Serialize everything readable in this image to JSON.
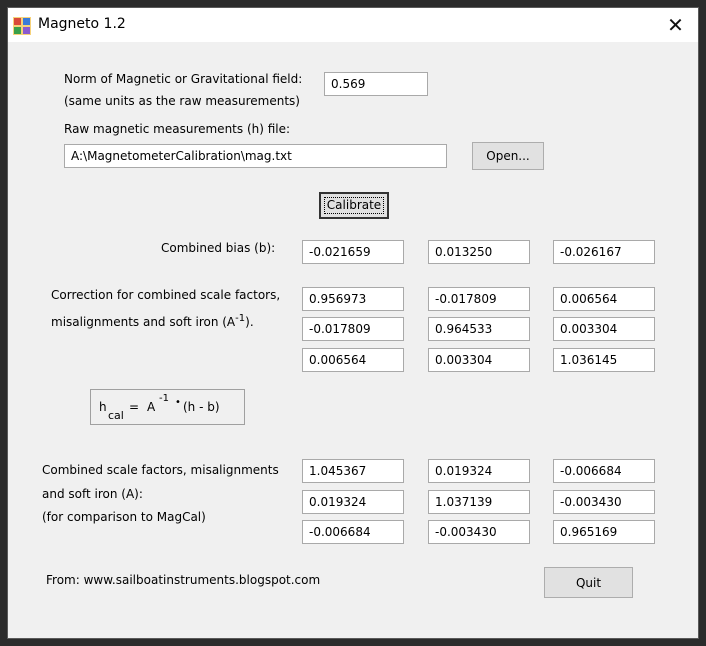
{
  "window": {
    "title": "Magneto 1.2",
    "close_glyph": "✕"
  },
  "norm": {
    "label_line1": "Norm of Magnetic or Gravitational field:",
    "label_line2": "(same units as the raw measurements)",
    "value": "0.569"
  },
  "file": {
    "label": "Raw magnetic measurements (h) file:",
    "path": "A:\\MagnetometerCalibration\\mag.txt",
    "open_label": "Open..."
  },
  "calibrate_label": "Calibrate",
  "bias": {
    "label": "Combined bias (b):",
    "values": [
      "-0.021659",
      "0.013250",
      "-0.026167"
    ]
  },
  "correction": {
    "label_line1": "Correction for combined scale factors,",
    "label_line2_main": "misalignments and soft iron (A",
    "label_line2_sup": "-1",
    "label_line2_end": ").",
    "rows": [
      [
        "0.956973",
        "-0.017809",
        "0.006564"
      ],
      [
        "-0.017809",
        "0.964533",
        "0.003304"
      ],
      [
        "0.006564",
        "0.003304",
        "1.036145"
      ]
    ]
  },
  "formula": {
    "h": "h",
    "cal": "cal",
    "eq": "=",
    "A": "A",
    "sup": "-1",
    "dot": "•",
    "rest": "(h - b)"
  },
  "scale": {
    "label_line1": "Combined scale factors, misalignments",
    "label_line2": "and soft iron (A):",
    "label_line3": "(for comparison to MagCal)",
    "rows": [
      [
        "1.045367",
        "0.019324",
        "-0.006684"
      ],
      [
        "0.019324",
        "1.037139",
        "-0.003430"
      ],
      [
        "-0.006684",
        "-0.003430",
        "0.965169"
      ]
    ]
  },
  "footer": {
    "from_text": "From: www.sailboatinstruments.blogspot.com",
    "quit_label": "Quit"
  }
}
